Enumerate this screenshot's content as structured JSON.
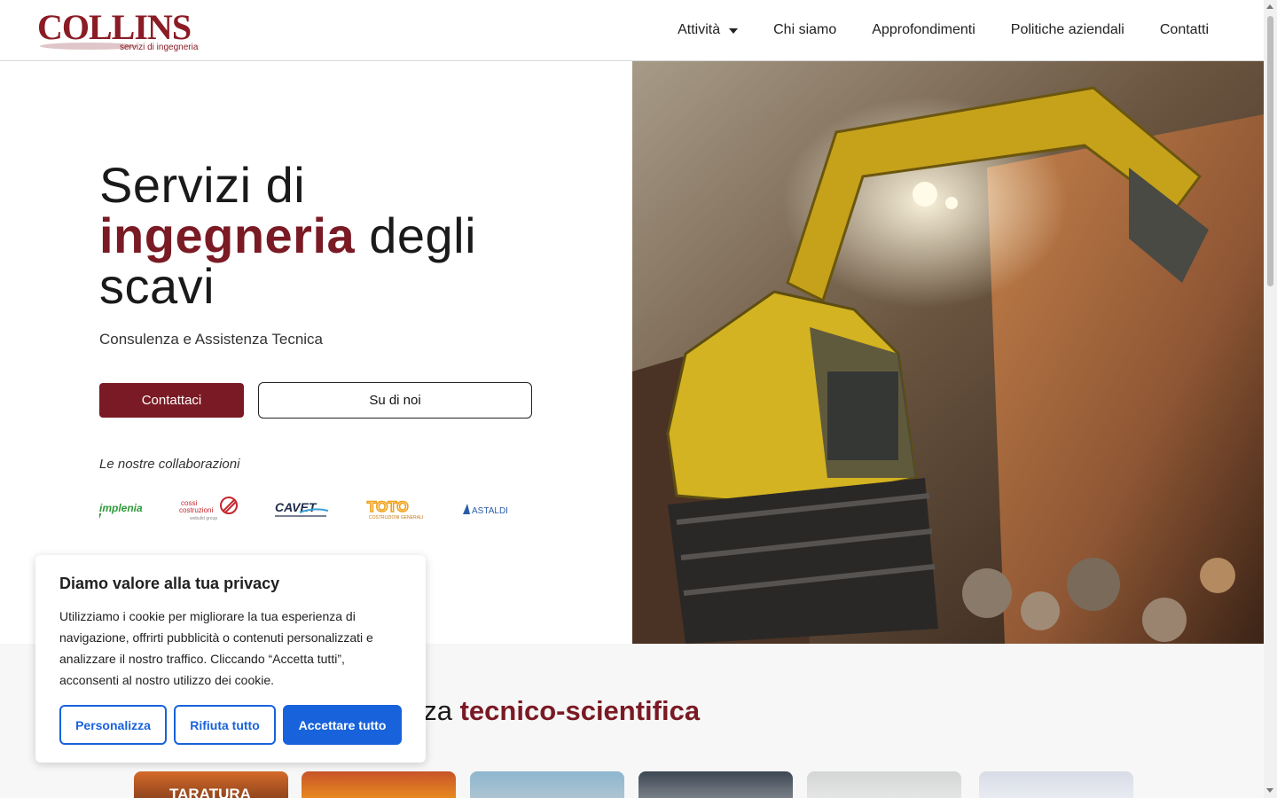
{
  "logo": {
    "text": "COLLINS",
    "tagline": "servizi di ingegneria"
  },
  "nav": {
    "items": [
      {
        "label": "Attività",
        "dropdown": true
      },
      {
        "label": "Chi siamo"
      },
      {
        "label": "Approfondimenti"
      },
      {
        "label": "Politiche aziendali"
      },
      {
        "label": "Contatti"
      }
    ]
  },
  "hero": {
    "title_line1": "Servizi di",
    "title_accent": "ingegneria",
    "title_rest": " degli",
    "title_line3": "scavi",
    "subtitle": "Consulenza e Assistenza Tecnica",
    "primary_button": "Contattaci",
    "secondary_button": "Su di noi",
    "collab_label": "Le nostre collaborazioni",
    "partners": [
      {
        "name": "implenia",
        "text": "implenia"
      },
      {
        "name": "cossi",
        "text": "cossi costruzioni"
      },
      {
        "name": "cavet",
        "text": "CAVET"
      },
      {
        "name": "toto",
        "text": "TOTO"
      },
      {
        "name": "astaldi",
        "text": "ASTALDI"
      }
    ]
  },
  "section2": {
    "title_visible": "nza ",
    "title_accent": "tecnico-scientifica",
    "first_card_label": "TARATURA"
  },
  "cookie": {
    "title": "Diamo valore alla tua privacy",
    "text": "Utilizziamo i cookie per migliorare la tua esperienza di navigazione, offrirti pubblicità o contenuti personalizzati e analizzare il nostro traffico. Cliccando “Accetta tutti”, acconsenti al nostro utilizzo dei cookie.",
    "customize": "Personalizza",
    "reject": "Rifiuta tutto",
    "accept": "Accettare tutto"
  },
  "colors": {
    "brand": "#7a1a24",
    "cookie_blue": "#1863dc"
  }
}
